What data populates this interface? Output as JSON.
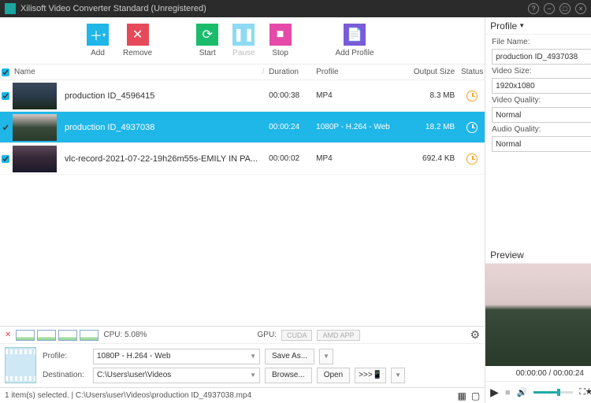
{
  "window": {
    "title": "Xilisoft Video Converter Standard (Unregistered)"
  },
  "toolbar": {
    "add": "Add",
    "remove": "Remove",
    "start": "Start",
    "pause": "Pause",
    "stop": "Stop",
    "add_profile": "Add Profile"
  },
  "columns": {
    "name": "Name",
    "duration": "Duration",
    "profile": "Profile",
    "output_size": "Output Size",
    "status": "Status"
  },
  "rows": [
    {
      "name": "production ID_4596415",
      "duration": "00:00:38",
      "profile": "MP4",
      "size": "8.3 MB",
      "selected": false,
      "checked": true
    },
    {
      "name": "production ID_4937038",
      "duration": "00:00:24",
      "profile": "1080P - H.264 - Web",
      "size": "18.2 MB",
      "selected": true,
      "checked": true
    },
    {
      "name": "vlc-record-2021-07-22-19h26m55s-EMILY IN PA...",
      "duration": "00:00:02",
      "profile": "MP4",
      "size": "692.4 KB",
      "selected": false,
      "checked": true
    }
  ],
  "stats": {
    "cpu_label": "CPU: 5.08%",
    "gpu_label": "GPU:",
    "cuda": "CUDA",
    "amd": "AMD APP"
  },
  "dest": {
    "profile_label": "Profile:",
    "profile_value": "1080P - H.264 - Web",
    "destination_label": "Destination:",
    "destination_value": "C:\\Users\\user\\Videos",
    "save_as": "Save As...",
    "browse": "Browse...",
    "open": "Open",
    "chevrons": ">>>"
  },
  "statusbar": {
    "text": "1 item(s) selected. | C:\\Users\\user\\Videos\\production ID_4937038.mp4"
  },
  "profile_panel": {
    "title": "Profile",
    "file_name_label": "File Name:",
    "file_name": "production ID_4937038",
    "video_size_label": "Video Size:",
    "video_size": "1920x1080",
    "video_quality_label": "Video Quality:",
    "video_quality": "Normal",
    "audio_quality_label": "Audio Quality:",
    "audio_quality": "Normal"
  },
  "preview": {
    "title": "Preview",
    "time": "00:00:00 / 00:00:24"
  }
}
